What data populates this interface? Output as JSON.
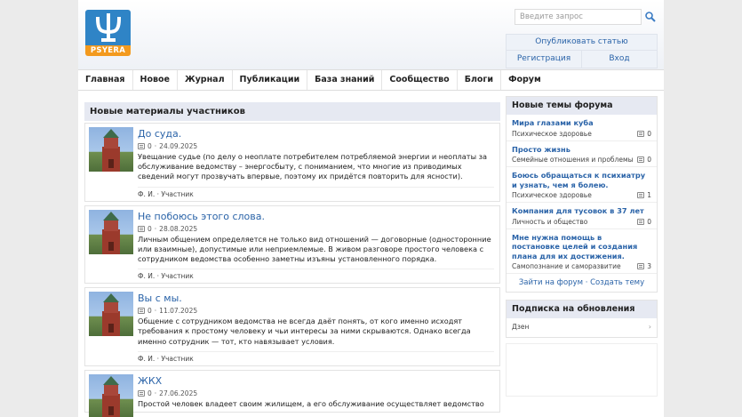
{
  "logo": {
    "text": "PSYERA"
  },
  "search": {
    "placeholder": "Введите запрос"
  },
  "auth": {
    "publish": "Опубликовать статью",
    "register": "Регистрация",
    "login": "Вход"
  },
  "nav": [
    "Главная",
    "Новое",
    "Журнал",
    "Публикации",
    "База знаний",
    "Сообщество",
    "Блоги",
    "Форум"
  ],
  "materials": {
    "title": "Новые материалы участников",
    "items": [
      {
        "title": "До суда.",
        "comments": "0",
        "date": "24.09.2025",
        "text": "Увещание судье (по делу о неоплате потребителем потребляемой энергии и неоплаты за обслуживание ведомству – энергосбыту, с пониманием, что многие из приводимых сведений могут прозвучать впервые, поэтому их придётся повторить для ясности).",
        "author": "Ф. И. · Участник"
      },
      {
        "title": "Не побоюсь этого слова.",
        "comments": "0",
        "date": "28.08.2025",
        "text": "Личным общением определяется не только вид отношений — договорные (односторонние или взаимные), допустимые или неприемлемые. В живом разговоре простого человека с сотрудником ведомства особенно заметны изъяны установленного порядка.",
        "author": "Ф. И. · Участник"
      },
      {
        "title": "Вы с мы.",
        "comments": "0",
        "date": "11.07.2025",
        "text": "Общение с сотрудником ведомства не всегда даёт понять, от кого именно исходят требования к простому человеку и чьи интересы за ними скрываются. Однако всегда именно сотрудник — тот, кто навязывает условия.",
        "author": "Ф. И. · Участник"
      },
      {
        "title": "ЖКХ",
        "comments": "0",
        "date": "27.06.2025",
        "text": "Простой человек владеет своим жилищем, а его обслуживание осуществляет ведомство",
        "author": ""
      }
    ]
  },
  "forum": {
    "title": "Новые темы форума",
    "topics": [
      {
        "title": "Мира глазами куба",
        "category": "Психическое здоровье",
        "count": "0"
      },
      {
        "title": "Просто жизнь",
        "category": "Семейные отношения и проблемы",
        "count": "0"
      },
      {
        "title": "Боюсь обращаться к психиатру и узнать, чем я болею.",
        "category": "Психическое здоровье",
        "count": "1"
      },
      {
        "title": "Компания для тусовок в 37 лет",
        "category": "Личность и общество",
        "count": "0"
      },
      {
        "title": "Мне нужна помощь в постановке целей и создания плана для их достижения.",
        "category": "Самопознание и саморазвитие",
        "count": "3"
      }
    ],
    "links": "Зайти на форум · Создать тему"
  },
  "subscribe": {
    "title": "Подписка на обновления",
    "item": "Дзен",
    "chevron": "›"
  },
  "colors": {
    "link": "#2a63a8",
    "block_header": "#e6e9f2",
    "logo_blue": "#2f84c6",
    "logo_orange": "#f39a1e"
  }
}
